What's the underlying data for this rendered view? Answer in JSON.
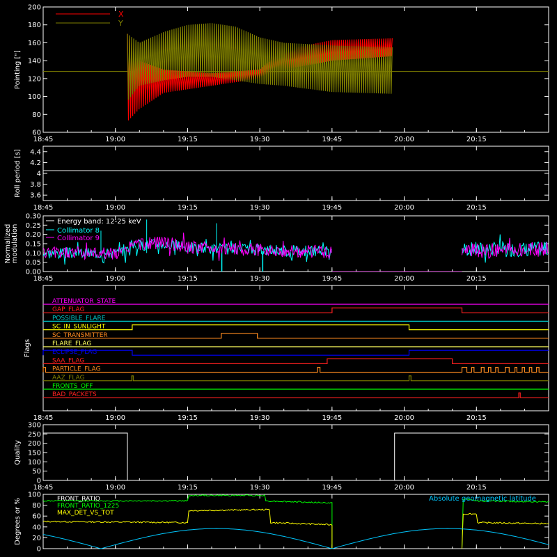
{
  "time_axis": {
    "labels": [
      "18:45",
      "19:00",
      "19:15",
      "19:30",
      "19:45",
      "20:00",
      "20:15"
    ],
    "minutes": [
      0,
      15,
      30,
      45,
      60,
      75,
      90
    ],
    "range_minutes": [
      0,
      105
    ]
  },
  "chart_data": [
    {
      "type": "line",
      "ylabel": "Pointing [\"]",
      "ylim": [
        60,
        200
      ],
      "yticks": [
        60,
        80,
        100,
        120,
        140,
        160,
        180,
        200
      ],
      "legend": "top-left",
      "series": [
        {
          "name": "X",
          "color": "#ff0000",
          "band": {
            "start": 17.5,
            "end": 72.5,
            "high": [
              [
                17.5,
                170
              ],
              [
                20,
                140
              ],
              [
                25,
                130
              ],
              [
                35,
                126
              ],
              [
                45,
                130
              ],
              [
                50,
                152
              ],
              [
                60,
                163
              ],
              [
                72.5,
                165
              ]
            ],
            "low": [
              [
                17.5,
                72
              ],
              [
                20,
                86
              ],
              [
                25,
                104
              ],
              [
                35,
                112
              ],
              [
                45,
                120
              ],
              [
                50,
                130
              ],
              [
                60,
                140
              ],
              [
                72.5,
                145
              ]
            ]
          }
        },
        {
          "name": "Y",
          "color": "#808000",
          "band": {
            "start": 17.5,
            "end": 72.5,
            "high": [
              [
                17.5,
                170
              ],
              [
                20,
                160
              ],
              [
                25,
                172
              ],
              [
                30,
                180
              ],
              [
                35,
                182
              ],
              [
                40,
                178
              ],
              [
                45,
                166
              ],
              [
                50,
                160
              ],
              [
                60,
                157
              ],
              [
                72.5,
                155
              ]
            ],
            "low": [
              [
                17.5,
                95
              ],
              [
                20,
                112
              ],
              [
                25,
                118
              ],
              [
                30,
                122
              ],
              [
                35,
                122
              ],
              [
                40,
                118
              ],
              [
                45,
                114
              ],
              [
                50,
                112
              ],
              [
                60,
                105
              ],
              [
                72.5,
                103
              ]
            ]
          }
        }
      ],
      "hline": {
        "value": 128,
        "color": "#808000"
      }
    },
    {
      "type": "line",
      "ylabel": "Roll period [s]",
      "ylim": [
        3.5,
        4.5
      ],
      "yticks": [
        3.6,
        3.8,
        4.0,
        4.2,
        4.4
      ],
      "series": [
        {
          "color": "#ffffff",
          "x": [
            0,
            105
          ],
          "values": [
            4.05,
            4.05
          ]
        }
      ]
    },
    {
      "type": "line",
      "ylabel": "Normalized modulation",
      "ylim": [
        0,
        0.3
      ],
      "yticks": [
        0,
        0.05,
        0.1,
        0.15,
        0.2,
        0.25,
        0.3
      ],
      "ytick_labels": [
        "0.00",
        "0.05",
        "0.10",
        "0.15",
        "0.20",
        "0.25",
        "0.30"
      ],
      "legend_title": "Energy band: 12-25 keV",
      "series": [
        {
          "name": "Collimator 8",
          "color": "#00ffff",
          "segments": [
            {
              "start": 0,
              "end": 60,
              "base": [
                [
                  0,
                  0.1
                ],
                [
                  17,
                  0.1
                ],
                [
                  18,
                  0.14
                ],
                [
                  25,
                  0.15
                ],
                [
                  30,
                  0.13
                ],
                [
                  40,
                  0.12
                ],
                [
                  55,
                  0.11
                ],
                [
                  60,
                  0.11
                ]
              ],
              "amp": 0.03,
              "seed": 3
            },
            {
              "start": 87,
              "end": 105,
              "base": [
                [
                  87,
                  0.12
                ],
                [
                  105,
                  0.12
                ]
              ],
              "amp": 0.04,
              "seed": 7
            }
          ],
          "zero": [
            [
              60,
              87
            ]
          ],
          "dropouts": [
            [
              37,
              37.8
            ],
            [
              45.5,
              46.5
            ]
          ]
        },
        {
          "name": "Collimator 9",
          "color": "#ff00ff",
          "segments": [
            {
              "start": 0,
              "end": 60,
              "base": [
                [
                  0,
                  0.1
                ],
                [
                  17,
                  0.1
                ],
                [
                  18,
                  0.14
                ],
                [
                  25,
                  0.16
                ],
                [
                  30,
                  0.13
                ],
                [
                  40,
                  0.12
                ],
                [
                  55,
                  0.11
                ],
                [
                  60,
                  0.1
                ]
              ],
              "amp": 0.035,
              "seed": 5
            },
            {
              "start": 87,
              "end": 105,
              "base": [
                [
                  87,
                  0.11
                ],
                [
                  105,
                  0.12
                ]
              ],
              "amp": 0.04,
              "seed": 9
            }
          ],
          "zero": [
            [
              60,
              87
            ]
          ]
        }
      ]
    },
    {
      "type": "table",
      "ylabel": "Flags",
      "flags": [
        {
          "name": "ATTENUATOR_STATE",
          "color": "#ff00ff",
          "changes": []
        },
        {
          "name": "GAP_FLAG",
          "color": "#ff2020",
          "changes": [
            [
              60,
              1
            ],
            [
              87,
              0
            ]
          ]
        },
        {
          "name": "POSSIBLE_FLARE",
          "color": "#00c8c8",
          "changes": []
        },
        {
          "name": "SC_IN_SUNLIGHT",
          "color": "#ffff00",
          "changes": [
            [
              18.5,
              1
            ],
            [
              76,
              0
            ]
          ]
        },
        {
          "name": "SC_TRANSMITTER",
          "color": "#ff8c20",
          "changes": [
            [
              37,
              1
            ],
            [
              44.5,
              0
            ]
          ]
        },
        {
          "name": "FLARE_FLAG",
          "color": "#ffff60",
          "changes": []
        },
        {
          "name": "ECLIPSE_FLAG",
          "color": "#0000ff",
          "changes": [
            [
              0,
              1
            ],
            [
              18.5,
              0
            ],
            [
              76,
              1
            ]
          ]
        },
        {
          "name": "SAA_FLAG",
          "color": "#ff2020",
          "changes": [
            [
              59,
              1
            ],
            [
              85,
              0
            ]
          ]
        },
        {
          "name": "PARTICLE_FLAG",
          "color": "#ff8c20",
          "changes": [
            [
              0,
              1
            ],
            [
              0.5,
              0
            ],
            [
              57,
              1
            ],
            [
              57.5,
              0
            ],
            [
              87,
              1
            ],
            [
              88,
              0
            ],
            [
              89,
              1
            ],
            [
              89.5,
              0
            ],
            [
              91,
              1
            ],
            [
              91.6,
              0
            ],
            [
              92.5,
              1
            ],
            [
              93,
              0
            ],
            [
              94,
              1
            ],
            [
              94.5,
              0
            ],
            [
              96,
              1
            ],
            [
              96.8,
              0
            ],
            [
              98,
              1
            ],
            [
              98.4,
              0
            ],
            [
              99.5,
              1
            ],
            [
              100,
              0
            ],
            [
              101,
              1
            ],
            [
              101.5,
              0
            ],
            [
              102.5,
              1
            ],
            [
              103,
              0
            ]
          ]
        },
        {
          "name": "AAZ_FLAG",
          "color": "#808000",
          "changes": [
            [
              18.4,
              1
            ],
            [
              18.7,
              0
            ],
            [
              76,
              1
            ],
            [
              76.4,
              0
            ]
          ]
        },
        {
          "name": "FRONTS_OFF",
          "color": "#00ff00",
          "changes": []
        },
        {
          "name": "BAD_PACKETS",
          "color": "#ff2020",
          "changes": [
            [
              98.8,
              1
            ],
            [
              99.1,
              0
            ]
          ]
        }
      ]
    },
    {
      "type": "line",
      "ylabel": "Quality",
      "ylim": [
        0,
        300
      ],
      "yticks": [
        0,
        50,
        100,
        150,
        200,
        250,
        300
      ],
      "series": [
        {
          "color": "#ffffff",
          "x": [
            0,
            17.5,
            17.5,
            73,
            73,
            105
          ],
          "values": [
            255,
            255,
            0,
            0,
            255,
            255
          ]
        }
      ]
    },
    {
      "type": "line",
      "ylabel": "Degrees or %",
      "ylim": [
        0,
        100
      ],
      "yticks": [
        0,
        20,
        40,
        60,
        80,
        100
      ],
      "legend_right": "Absolute geomagnetic latitude",
      "series": [
        {
          "name": "FRONT_RATIO",
          "color": "#ffffff",
          "x": [],
          "values": []
        },
        {
          "name": "FRONT_RATIO_1225",
          "color": "#00ff00",
          "segments": [
            {
              "start": 0,
              "end": 60,
              "base": [
                [
                  0,
                  88
                ],
                [
                  30,
                  88
                ],
                [
                  30,
                  98
                ],
                [
                  46,
                  98
                ],
                [
                  46,
                  88
                ],
                [
                  60,
                  84
                ],
                [
                  60,
                  0
                ]
              ]
            },
            {
              "start": 87,
              "end": 105,
              "base": [
                [
                  87,
                  0
                ],
                [
                  87,
                  92
                ],
                [
                  90,
                  88
                ],
                [
                  105,
                  86
                ]
              ]
            }
          ]
        },
        {
          "name": "MAX_DET_VS_TOT",
          "color": "#ffff00",
          "segments": [
            {
              "start": 0,
              "end": 60,
              "base": [
                [
                  0,
                  50
                ],
                [
                  30,
                  48
                ],
                [
                  30,
                  70
                ],
                [
                  47,
                  72
                ],
                [
                  47,
                  48
                ],
                [
                  60,
                  44
                ],
                [
                  60,
                  0
                ]
              ]
            },
            {
              "start": 87,
              "end": 105,
              "base": [
                [
                  87,
                  0
                ],
                [
                  87,
                  64
                ],
                [
                  90,
                  64
                ],
                [
                  90,
                  48
                ],
                [
                  105,
                  46
                ]
              ]
            }
          ]
        },
        {
          "name": "",
          "color": "#00c8ff",
          "geomag": {
            "period": 60,
            "peak": 37,
            "zeros": [
              12,
              60
            ]
          }
        }
      ]
    }
  ]
}
